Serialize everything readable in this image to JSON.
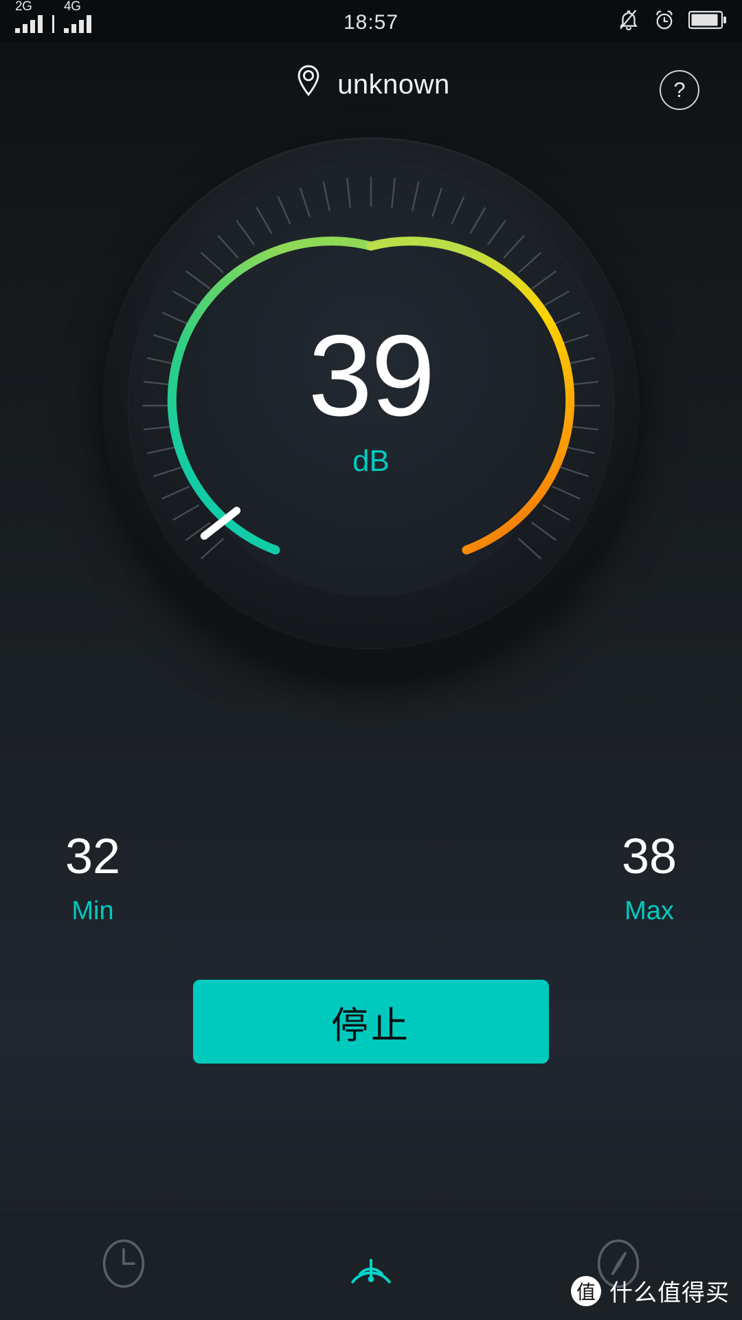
{
  "status_bar": {
    "sim1": {
      "network": "2G",
      "signal_bars": 4
    },
    "sim2": {
      "network": "4G",
      "signal_bars": 4
    },
    "time": "18:57",
    "icons": [
      "bell-mute-icon",
      "alarm-clock-icon",
      "battery-icon"
    ]
  },
  "header": {
    "location_icon": "location-pin-icon",
    "location_label": "unknown",
    "help_label": "?"
  },
  "gauge": {
    "value": "39",
    "unit": "dB",
    "needle_icon": "gauge-needle-icon",
    "colors": {
      "arc_start": "#00c9a7",
      "arc_green": "#3fd07a",
      "arc_yellowgreen": "#a8dc50",
      "arc_yellow": "#ffd400",
      "arc_orange": "#e8630a",
      "accent": "#00cbc0"
    }
  },
  "stats": {
    "min": {
      "value": "32",
      "label": "Min"
    },
    "max": {
      "value": "38",
      "label": "Max"
    }
  },
  "action": {
    "label": "停止"
  },
  "tabs": [
    {
      "name": "history",
      "icon": "clock-icon",
      "active": false
    },
    {
      "name": "meter",
      "icon": "gauge-icon",
      "active": true
    },
    {
      "name": "compass",
      "icon": "compass-icon",
      "active": false
    }
  ],
  "watermark": {
    "badge": "值",
    "text": "什么值得买"
  },
  "chart_data": {
    "type": "gauge",
    "title": "Sound level meter",
    "value": 39,
    "unit": "dB",
    "min_recorded": 32,
    "max_recorded": 38,
    "arc_sweep_degrees": 252,
    "gradient_stops": [
      "#00c9a7",
      "#3fd07a",
      "#a8dc50",
      "#ffd400",
      "#e8630a"
    ],
    "ticks": 45,
    "grid": false
  }
}
